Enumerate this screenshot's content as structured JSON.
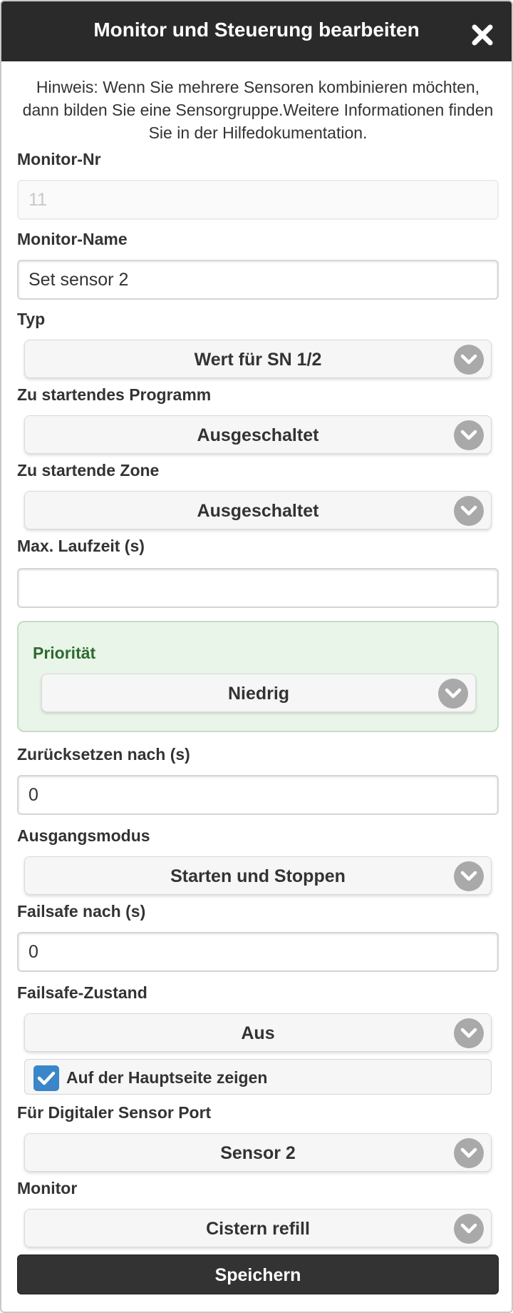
{
  "dialog": {
    "title": "Monitor und Steuerung bearbeiten",
    "note": "Hinweis: Wenn Sie mehrere Sensoren kombinieren möchten, dann bilden Sie eine Sensorgruppe.Weitere Informationen finden Sie in der Hilfedokumentation."
  },
  "fields": {
    "monitor_nr_label": "Monitor-Nr",
    "monitor_nr_value": "11",
    "monitor_name_label": "Monitor-Name",
    "monitor_name_value": "Set sensor 2",
    "typ_label": "Typ",
    "typ_value": "Wert für SN 1/2",
    "program_label": "Zu startendes Programm",
    "program_value": "Ausgeschaltet",
    "zone_label": "Zu startende Zone",
    "zone_value": "Ausgeschaltet",
    "max_runtime_label": "Max. Laufzeit (s)",
    "max_runtime_value": "",
    "priority_label": "Priorität",
    "priority_value": "Niedrig",
    "reset_label": "Zurücksetzen nach (s)",
    "reset_value": "0",
    "output_mode_label": "Ausgangsmodus",
    "output_mode_value": "Starten und Stoppen",
    "failsafe_after_label": "Failsafe nach (s)",
    "failsafe_after_value": "0",
    "failsafe_state_label": "Failsafe-Zustand",
    "failsafe_state_value": "Aus",
    "show_main_label": "Auf der Hauptseite zeigen",
    "show_main_checked": true,
    "digital_port_label": "Für Digitaler Sensor Port",
    "digital_port_value": "Sensor 2",
    "monitor_label": "Monitor",
    "monitor_value": "Cistern refill"
  },
  "buttons": {
    "save": "Speichern"
  },
  "colors": {
    "header_bg": "#2a2a2a",
    "priority_bg": "#e9f5e9",
    "priority_text": "#2e6a2e",
    "checkbox": "#3a86c8",
    "save_bg": "#333333"
  }
}
